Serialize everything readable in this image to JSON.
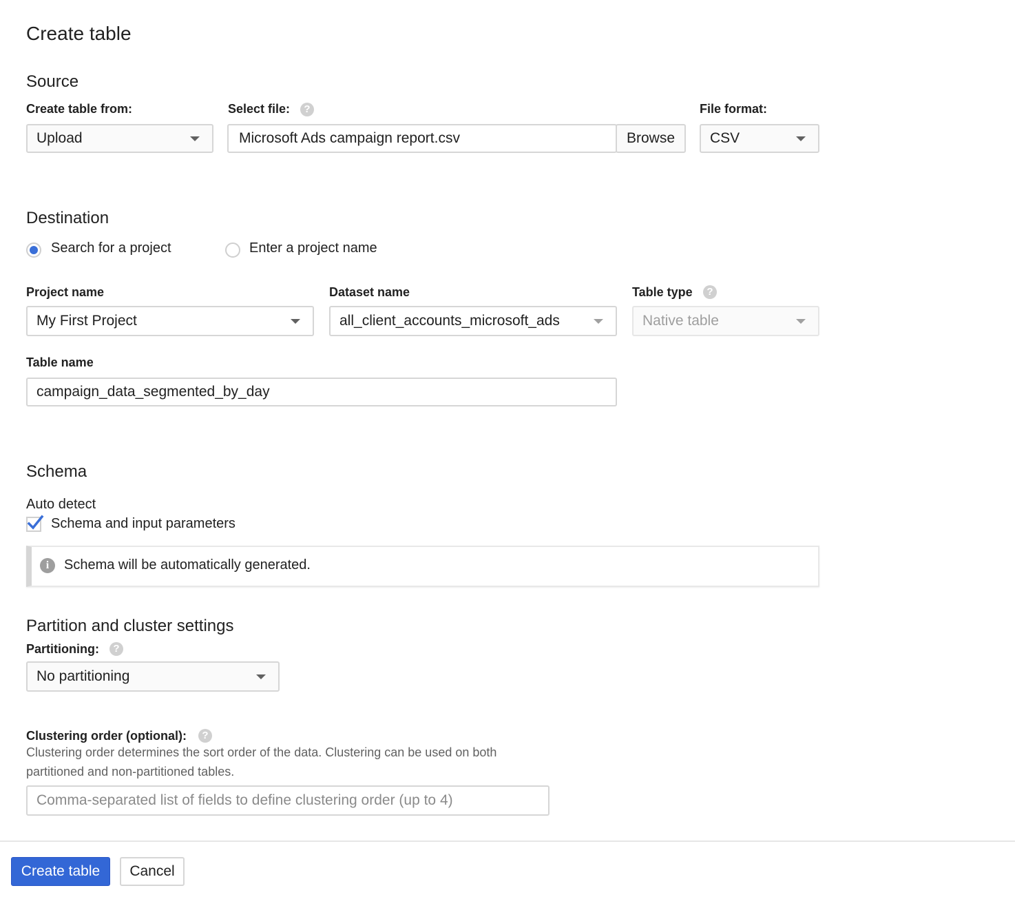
{
  "title": "Create table",
  "source": {
    "heading": "Source",
    "create_from_label": "Create table from:",
    "create_from_value": "Upload",
    "select_file_label": "Select file:",
    "select_file_value": "Microsoft Ads campaign report.csv",
    "browse_label": "Browse",
    "file_format_label": "File format:",
    "file_format_value": "CSV"
  },
  "destination": {
    "heading": "Destination",
    "radio_search": "Search for a project",
    "radio_enter": "Enter a project name",
    "project_label": "Project name",
    "project_value": "My First Project",
    "dataset_label": "Dataset name",
    "dataset_value": "all_client_accounts_microsoft_ads",
    "table_type_label": "Table type",
    "table_type_value": "Native table",
    "table_name_label": "Table name",
    "table_name_value": "campaign_data_segmented_by_day"
  },
  "schema": {
    "heading": "Schema",
    "auto_detect_label": "Auto detect",
    "checkbox_label": "Schema and input parameters",
    "checkbox_checked": true,
    "info_text": "Schema will be automatically generated."
  },
  "partition": {
    "heading": "Partition and cluster settings",
    "partitioning_label": "Partitioning:",
    "partitioning_value": "No partitioning",
    "clustering_label": "Clustering order (optional):",
    "clustering_desc_1": "Clustering order determines the sort order of the data. Clustering can be used on both",
    "clustering_desc_2": "partitioned and non-partitioned tables.",
    "clustering_placeholder": "Comma-separated list of fields to define clustering order (up to 4)"
  },
  "footer": {
    "create_label": "Create table",
    "cancel_label": "Cancel"
  },
  "icons": {
    "help": "?",
    "info": "i"
  },
  "colors": {
    "primary": "#3367d6",
    "radio_selected": "#3a6fd8"
  }
}
